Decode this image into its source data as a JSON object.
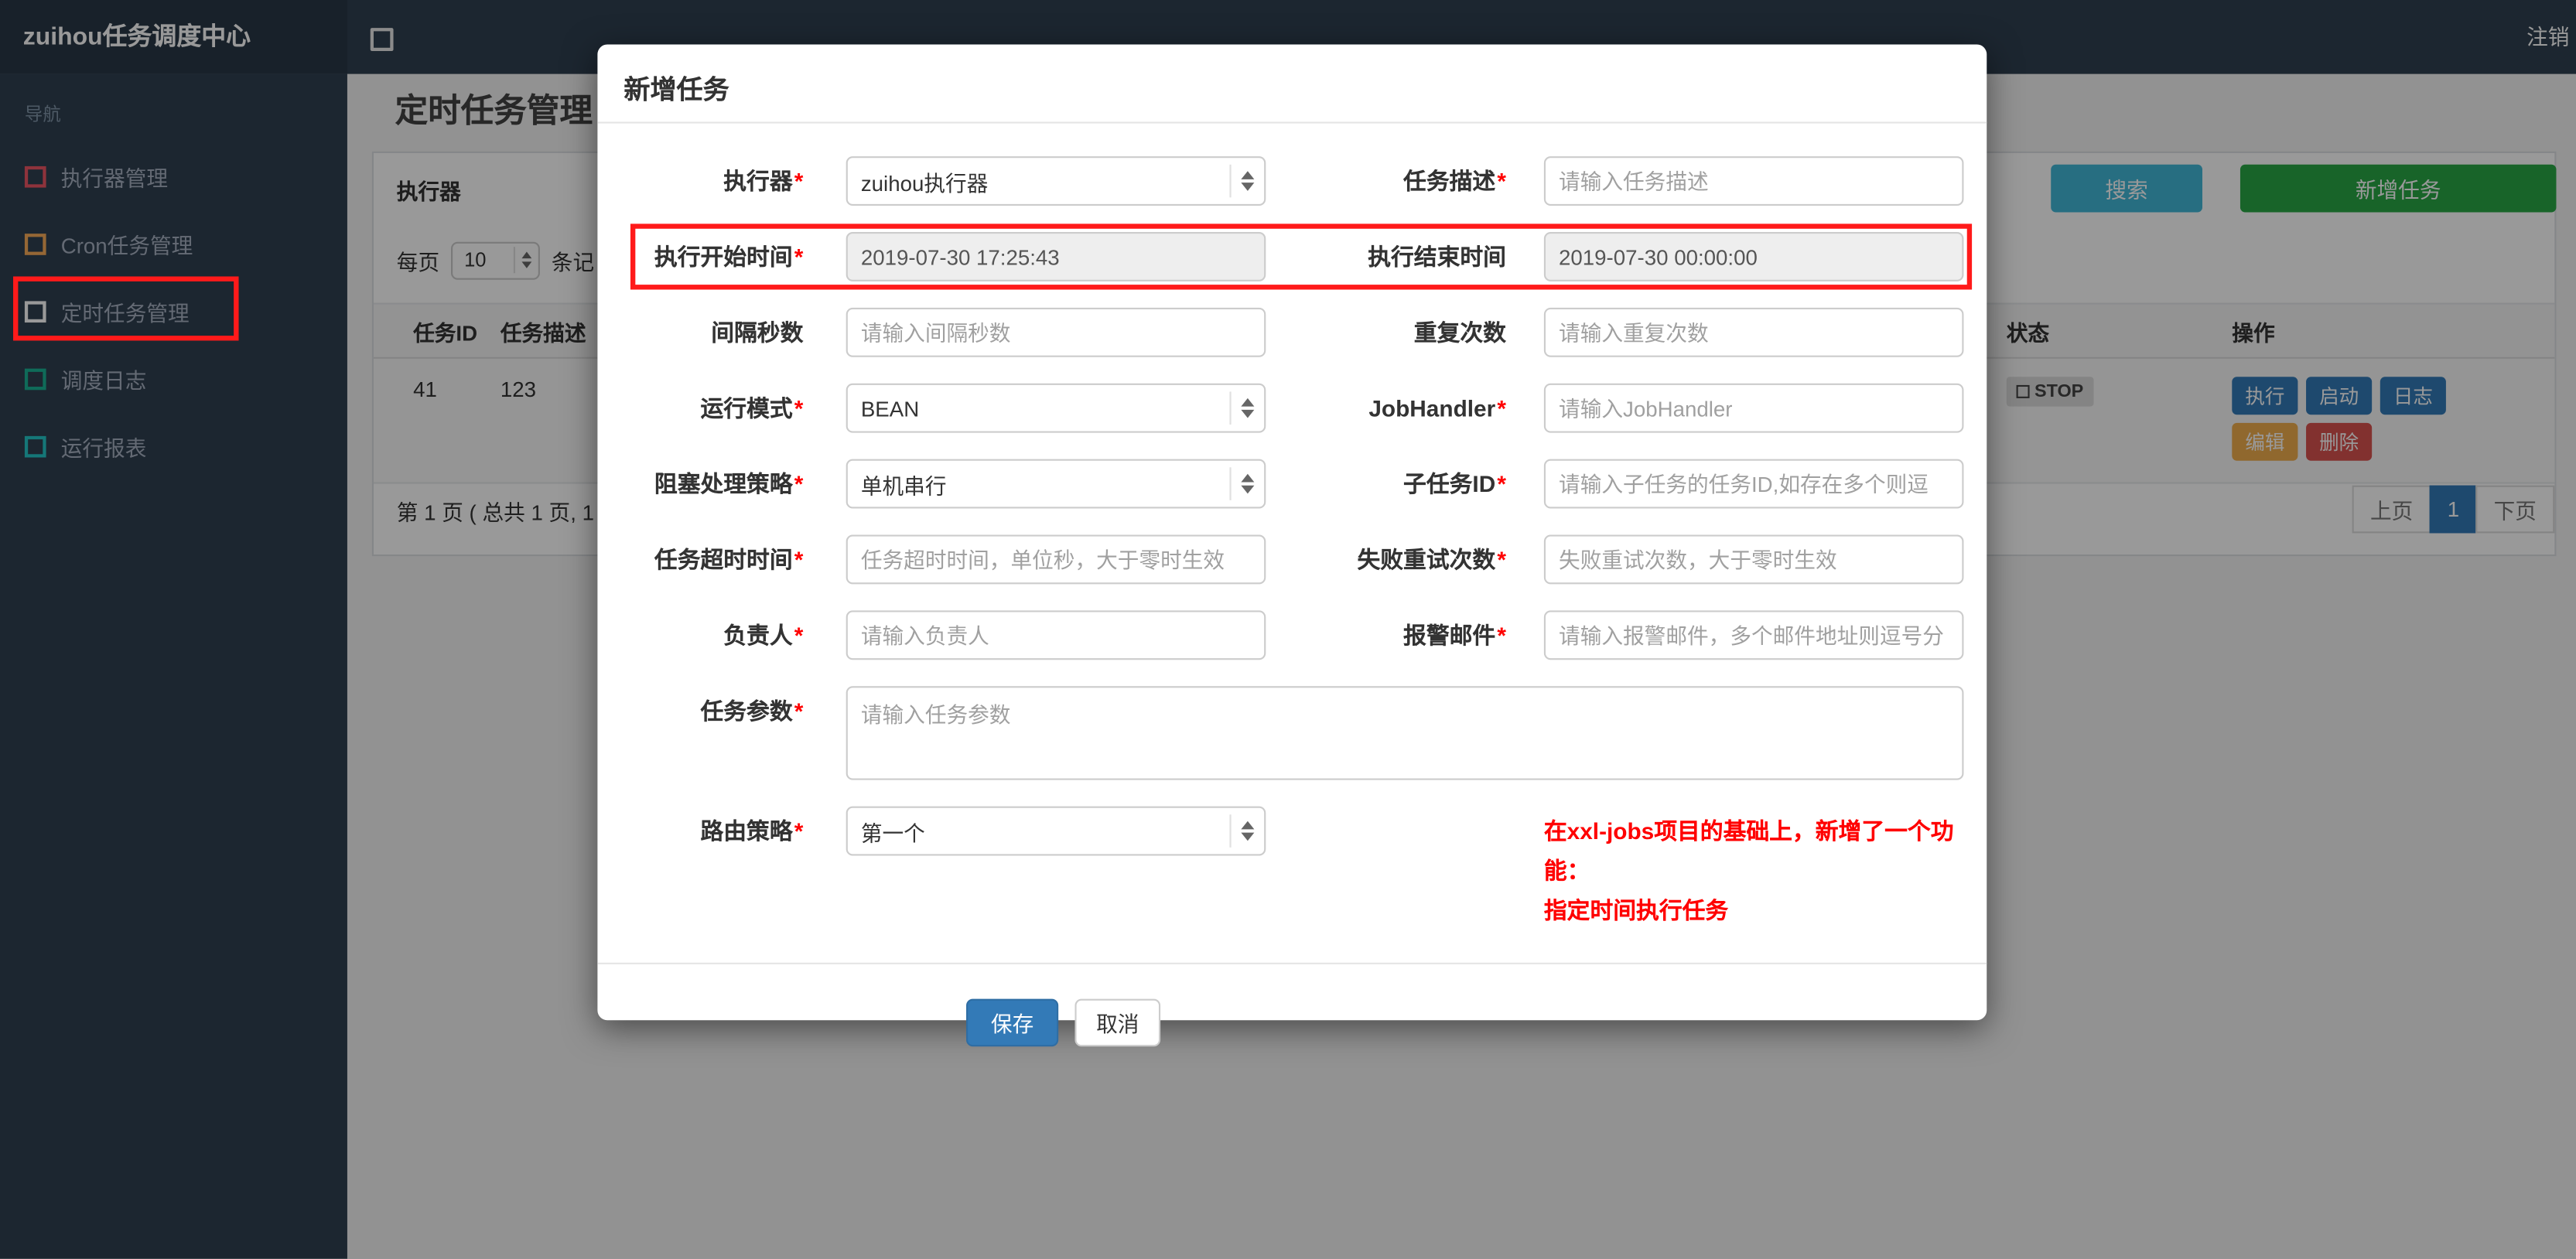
{
  "colors": {
    "topbar_bg": "#2f4050",
    "brand_bg": "#293846",
    "sidebar_bg": "#2f4050",
    "page_bg": "#f3f3f4",
    "primary": "#337ab7",
    "search_button": "#41b8d8",
    "add_button": "#28a745",
    "edit_button": "#f0ad4e",
    "delete_button": "#d9534f",
    "annotation_red": "#ff1a1a",
    "required_red": "#ff0000"
  },
  "navbar": {
    "brand": "zuihou任务调度中心",
    "logout": "注销"
  },
  "sidebar": {
    "heading": "导航",
    "items": [
      {
        "label": "执行器管理",
        "icon": "square-outline-icon",
        "icon_color": "#ed5565"
      },
      {
        "label": "Cron任务管理",
        "icon": "square-outline-icon",
        "icon_color": "#f8ac59"
      },
      {
        "label": "定时任务管理",
        "icon": "square-outline-icon",
        "icon_color": "#ffffff",
        "active": true
      },
      {
        "label": "调度日志",
        "icon": "square-outline-icon",
        "icon_color": "#1ab394"
      },
      {
        "label": "运行报表",
        "icon": "square-outline-icon",
        "icon_color": "#23c6c8"
      }
    ]
  },
  "page": {
    "title": "定时任务管理",
    "filter": {
      "executor_label": "执行器",
      "search_button": "搜索",
      "add_button": "新增任务"
    },
    "per_page": {
      "label": "每页",
      "value": "10",
      "suffix": "条记"
    },
    "table": {
      "headers": [
        "任务ID",
        "任务描述",
        "状态",
        "操作"
      ],
      "row": {
        "task_id": "41",
        "description": "123",
        "status": "STOP",
        "actions": {
          "run": "执行",
          "start": "启动",
          "log": "日志",
          "edit": "编辑",
          "delete": "删除"
        }
      }
    },
    "pagination": {
      "summary": "第 1 页 ( 总共 1 页, 1",
      "prev": "上页",
      "current": "1",
      "next": "下页"
    }
  },
  "modal": {
    "title": "新增任务",
    "required_mark": "*",
    "fields": {
      "executor": {
        "label": "执行器",
        "value": "zuihou执行器"
      },
      "job_desc": {
        "label": "任务描述",
        "placeholder": "请输入任务描述"
      },
      "start_time": {
        "label": "执行开始时间",
        "value": "2019-07-30 17:25:43"
      },
      "end_time": {
        "label": "执行结束时间",
        "value": "2019-07-30 00:00:00"
      },
      "interval": {
        "label": "间隔秒数",
        "placeholder": "请输入间隔秒数"
      },
      "repeat_count": {
        "label": "重复次数",
        "placeholder": "请输入重复次数"
      },
      "glue_type": {
        "label": "运行模式",
        "value": "BEAN"
      },
      "job_handler": {
        "label": "JobHandler",
        "placeholder": "请输入JobHandler"
      },
      "block_strategy": {
        "label": "阻塞处理策略",
        "value": "单机串行"
      },
      "child_job_id": {
        "label": "子任务ID",
        "placeholder": "请输入子任务的任务ID,如存在多个则逗"
      },
      "timeout": {
        "label": "任务超时时间",
        "placeholder": "任务超时时间，单位秒，大于零时生效"
      },
      "fail_retry": {
        "label": "失败重试次数",
        "placeholder": "失败重试次数，大于零时生效"
      },
      "author": {
        "label": "负责人",
        "placeholder": "请输入负责人"
      },
      "alarm_email": {
        "label": "报警邮件",
        "placeholder": "请输入报警邮件，多个邮件地址则逗号分"
      },
      "job_param": {
        "label": "任务参数",
        "placeholder": "请输入任务参数"
      },
      "route_strategy": {
        "label": "路由策略",
        "value": "第一个"
      }
    },
    "note": {
      "line1": "在xxl-jobs项目的基础上，新增了一个功能：",
      "line2": "指定时间执行任务"
    },
    "save_button": "保存",
    "cancel_button": "取消"
  }
}
